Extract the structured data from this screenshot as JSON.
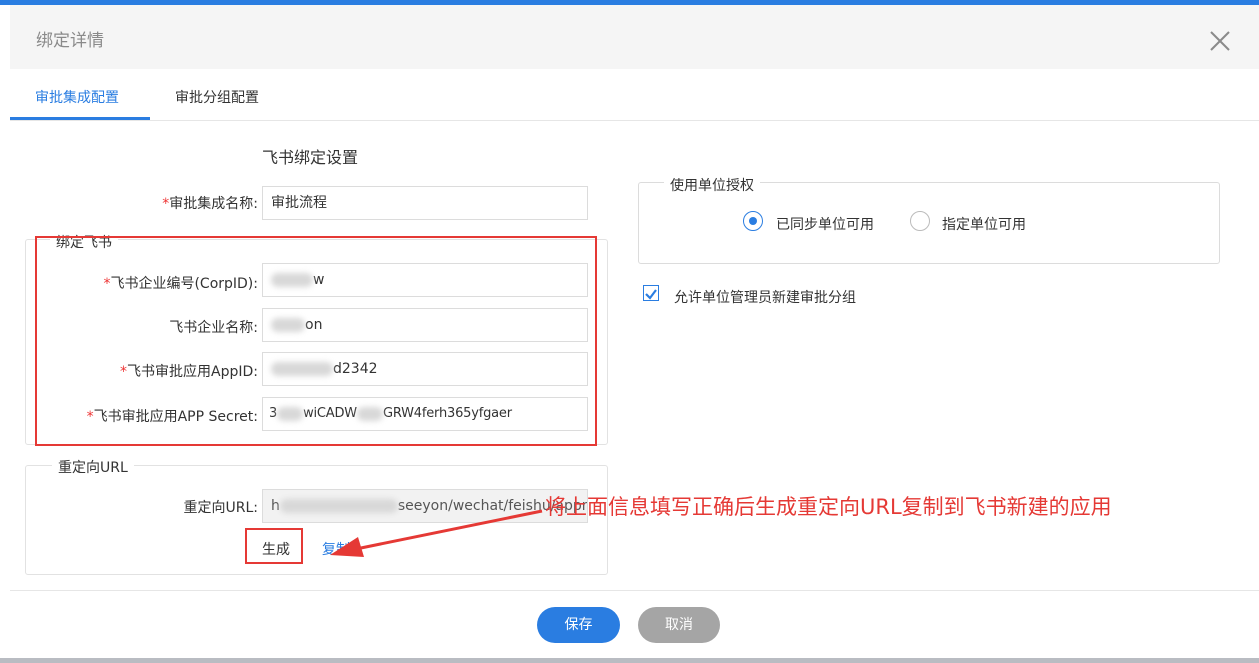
{
  "dialog": {
    "title": "绑定详情"
  },
  "tabs": [
    {
      "label": "审批集成配置",
      "active": true
    },
    {
      "label": "审批分组配置",
      "active": false
    }
  ],
  "form": {
    "section_title": "飞书绑定设置",
    "required_mark": "*",
    "integration_name": {
      "label": "审批集成名称:",
      "value": "审批流程"
    },
    "bind_group": {
      "legend": "绑定飞书",
      "corp_id": {
        "label": "飞书企业编号(CorpID):",
        "value": "w"
      },
      "corp_name": {
        "label": "飞书企业名称:",
        "value": "on"
      },
      "app_id": {
        "label": "飞书审批应用AppID:",
        "value": "d2342"
      },
      "app_secret": {
        "label": "飞书审批应用APP Secret:",
        "value_start": "3",
        "value_mid": "wiCADW",
        "value_end": "GRW4ferh365yfgaer"
      }
    },
    "redirect_group": {
      "legend": "重定向URL",
      "url": {
        "label": "重定向URL:",
        "value_start": "h",
        "value_visible": "seeyon/wechat/feishu/appro"
      },
      "generate_label": "生成",
      "copy_label": "复制"
    }
  },
  "auth_panel": {
    "legend": "使用单位授权",
    "options": [
      {
        "label": "已同步单位可用",
        "selected": true
      },
      {
        "label": "指定单位可用",
        "selected": false
      }
    ],
    "allow_admin": {
      "label": "允许单位管理员新建审批分组",
      "checked": true
    }
  },
  "annotation": "将上面信息填写正确后生成重定向URL复制到飞书新建的应用",
  "footer": {
    "save_label": "保存",
    "cancel_label": "取消"
  },
  "colors": {
    "accent": "#2a7de1",
    "annotation_red": "#e53935",
    "cancel_gray": "#a5a5a5"
  },
  "icons": {
    "close": "close-icon",
    "arrow": "annotation-arrow-icon",
    "check": "check-icon"
  }
}
